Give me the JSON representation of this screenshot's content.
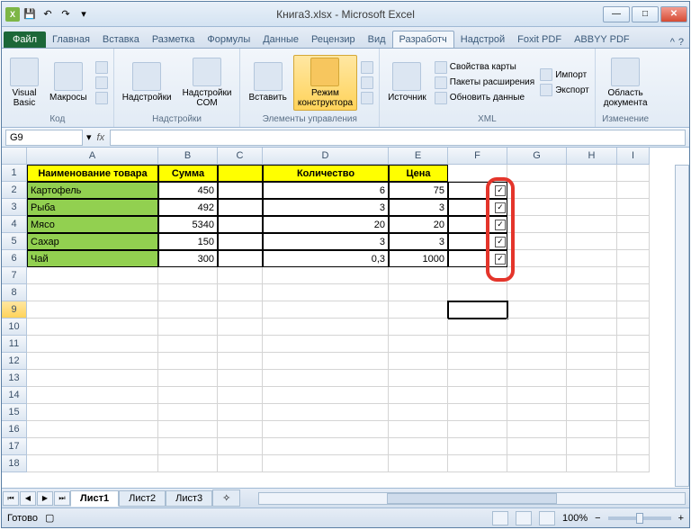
{
  "window": {
    "title": "Книга3.xlsx - Microsoft Excel"
  },
  "qat": {
    "save": "💾",
    "undo": "↶",
    "redo": "↷"
  },
  "tabs": {
    "file": "Файл",
    "items": [
      "Главная",
      "Вставка",
      "Разметка",
      "Формулы",
      "Данные",
      "Рецензир",
      "Вид",
      "Разработч",
      "Надстрой",
      "Foxit PDF",
      "ABBYY PDF"
    ],
    "active_index": 7
  },
  "ribbon": {
    "code": {
      "label": "Код",
      "vb": "Visual\nBasic",
      "macros": "Макросы"
    },
    "addins": {
      "label": "Надстройки",
      "btn1": "Надстройки",
      "btn2": "Надстройки\nCOM"
    },
    "controls": {
      "label": "Элементы управления",
      "insert": "Вставить",
      "design": "Режим\nконструктора"
    },
    "xml": {
      "label": "XML",
      "source": "Источник",
      "l1": "Свойства карты",
      "l2": "Пакеты расширения",
      "l3": "Обновить данные",
      "r1": "Импорт",
      "r2": "Экспорт"
    },
    "change": {
      "label": "Изменение",
      "btn": "Область\nдокумента"
    }
  },
  "namebox": "G9",
  "cols": [
    "",
    "A",
    "B",
    "C",
    "D",
    "E",
    "F",
    "G",
    "H",
    "I"
  ],
  "headers": {
    "name": "Наименование товара",
    "sum": "Сумма",
    "qty": "Количество",
    "price": "Цена"
  },
  "rows": [
    {
      "n": "1"
    },
    {
      "n": "2",
      "name": "Картофель",
      "sum": "450",
      "qty": "6",
      "price": "75",
      "chk": true
    },
    {
      "n": "3",
      "name": "Рыба",
      "sum": "492",
      "qty": "3",
      "price": "3",
      "chk": true
    },
    {
      "n": "4",
      "name": "Мясо",
      "sum": "5340",
      "qty": "20",
      "price": "20",
      "chk": true
    },
    {
      "n": "5",
      "name": "Сахар",
      "sum": "150",
      "qty": "3",
      "price": "3",
      "chk": true
    },
    {
      "n": "6",
      "name": "Чай",
      "sum": "300",
      "qty": "0,3",
      "price": "1000",
      "chk": true
    }
  ],
  "empty_rows": [
    "7",
    "8",
    "9",
    "10",
    "11",
    "12",
    "13",
    "14",
    "15",
    "16",
    "17",
    "18"
  ],
  "selected_row": "9",
  "sheets": {
    "s1": "Лист1",
    "s2": "Лист2",
    "s3": "Лист3"
  },
  "status": {
    "ready": "Готово",
    "zoom": "100%"
  }
}
